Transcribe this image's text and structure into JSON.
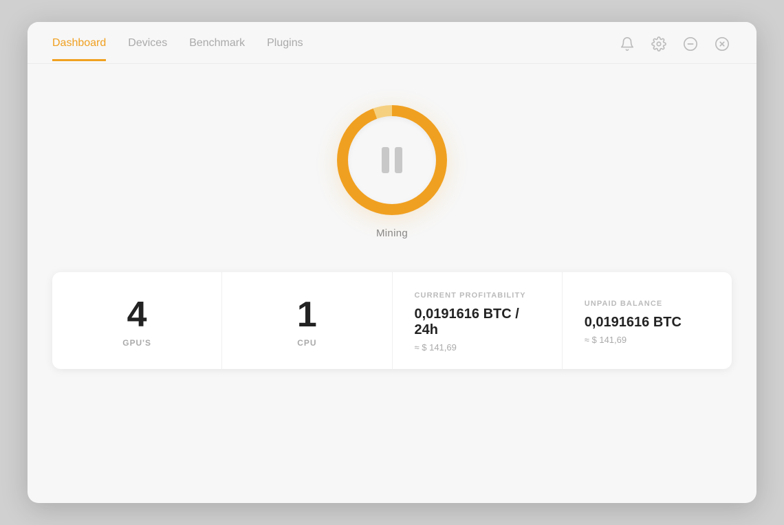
{
  "nav": {
    "links": [
      {
        "label": "Dashboard",
        "active": true
      },
      {
        "label": "Devices",
        "active": false
      },
      {
        "label": "Benchmark",
        "active": false
      },
      {
        "label": "Plugins",
        "active": false
      }
    ]
  },
  "mining": {
    "label": "Mining",
    "state": "paused"
  },
  "stats": [
    {
      "type": "number",
      "value": "4",
      "label": "GPU'S"
    },
    {
      "type": "number",
      "value": "1",
      "label": "CPU"
    },
    {
      "type": "profitability",
      "section_label": "CURRENT PROFITABILITY",
      "main_value": "0,0191616 BTC / 24h",
      "sub_value": "≈ $ 141,69"
    },
    {
      "type": "balance",
      "section_label": "UNPAID BALANCE",
      "main_value": "0,0191616 BTC",
      "sub_value": "≈ $ 141,69"
    }
  ],
  "icons": {
    "bell": "bell-icon",
    "gear": "gear-icon",
    "minus": "minimize-icon",
    "close": "close-icon"
  }
}
